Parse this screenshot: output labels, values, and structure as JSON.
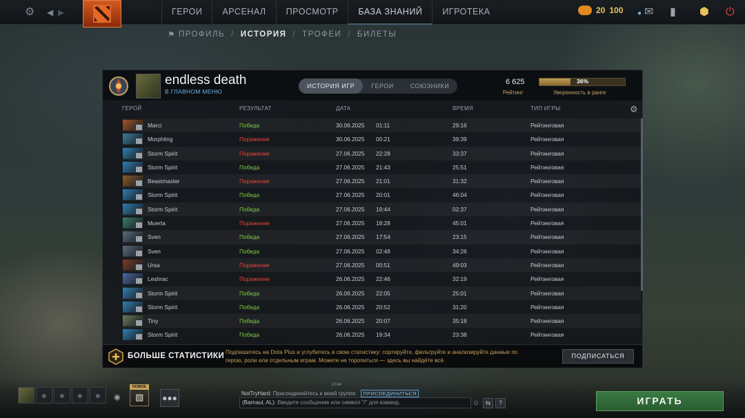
{
  "top_nav": {
    "items": [
      "ГЕРОИ",
      "АРСЕНАЛ",
      "ПРОСМОТР",
      "БАЗА ЗНАНИЙ",
      "ИГРОТЕКА"
    ],
    "currency_left": "20",
    "currency_right": "100"
  },
  "sub_nav": {
    "profile": "ПРОФИЛЬ",
    "history": "ИСТОРИЯ",
    "trophies": "ТРОФЕИ",
    "tickets": "БИЛЕТЫ"
  },
  "player": {
    "name": "endless death",
    "status": "В ГЛАВНОМ МЕНЮ"
  },
  "tabs": {
    "history": "ИСТОРИЯ ИГР",
    "heroes": "ГЕРОИ",
    "allies": "СОЮЗНИКИ"
  },
  "rating": {
    "value": "6 625",
    "label": "Рейтинг",
    "confidence_value": "36%",
    "confidence_fraction": 0.36,
    "confidence_label": "Уверенность в ранге"
  },
  "columns": {
    "hero": "ГЕРОЙ",
    "result": "РЕЗУЛЬТАТ",
    "date": "ДАТА",
    "duration": "ВРЕМЯ",
    "type": "ТИП ИГРЫ"
  },
  "matches": [
    {
      "hero": "Marci",
      "result": "Победа",
      "win": true,
      "date": "30.06.2025",
      "time": "01:11",
      "duration": "29:16",
      "type": "Рейтинговая",
      "color": "#a2532a"
    },
    {
      "hero": "Morphling",
      "result": "Поражение",
      "win": false,
      "date": "30.06.2025",
      "time": "00:21",
      "duration": "39:39",
      "type": "Рейтинговая",
      "color": "#3b7f9a"
    },
    {
      "hero": "Storm Spirit",
      "result": "Поражение",
      "win": false,
      "date": "27.06.2025",
      "time": "22:28",
      "duration": "33:37",
      "type": "Рейтинговая",
      "color": "#2f7fb0"
    },
    {
      "hero": "Storm Spirit",
      "result": "Победа",
      "win": true,
      "date": "27.06.2025",
      "time": "21:43",
      "duration": "25:51",
      "type": "Рейтинговая",
      "color": "#2f7fb0"
    },
    {
      "hero": "Beastmaster",
      "result": "Поражение",
      "win": false,
      "date": "27.06.2025",
      "time": "21:01",
      "duration": "31:32",
      "type": "Рейтинговая",
      "color": "#8a5a2a"
    },
    {
      "hero": "Storm Spirit",
      "result": "Победа",
      "win": true,
      "date": "27.06.2025",
      "time": "20:01",
      "duration": "46:04",
      "type": "Рейтинговая",
      "color": "#2f7fb0"
    },
    {
      "hero": "Storm Spirit",
      "result": "Победа",
      "win": true,
      "date": "27.06.2025",
      "time": "19:44",
      "duration": "02:37",
      "type": "Рейтинговая",
      "color": "#2f7fb0"
    },
    {
      "hero": "Muerta",
      "result": "Поражение",
      "win": false,
      "date": "27.06.2025",
      "time": "18:28",
      "duration": "45:01",
      "type": "Рейтинговая",
      "color": "#3a7a6a"
    },
    {
      "hero": "Sven",
      "result": "Победа",
      "win": true,
      "date": "27.06.2025",
      "time": "17:54",
      "duration": "23:15",
      "type": "Рейтинговая",
      "color": "#5a6a7a"
    },
    {
      "hero": "Sven",
      "result": "Победа",
      "win": true,
      "date": "27.06.2025",
      "time": "02:48",
      "duration": "34:26",
      "type": "Рейтинговая",
      "color": "#5a6a7a"
    },
    {
      "hero": "Ursa",
      "result": "Поражение",
      "win": false,
      "date": "27.06.2025",
      "time": "00:51",
      "duration": "49:03",
      "type": "Рейтинговая",
      "color": "#7a3a2a"
    },
    {
      "hero": "Leshrac",
      "result": "Поражение",
      "win": false,
      "date": "26.06.2025",
      "time": "22:46",
      "duration": "32:19",
      "type": "Рейтинговая",
      "color": "#4a6aa0"
    },
    {
      "hero": "Storm Spirit",
      "result": "Победа",
      "win": true,
      "date": "26.06.2025",
      "time": "22:05",
      "duration": "25:01",
      "type": "Рейтинговая",
      "color": "#2f7fb0"
    },
    {
      "hero": "Storm Spirit",
      "result": "Победа",
      "win": true,
      "date": "26.06.2025",
      "time": "20:52",
      "duration": "31:20",
      "type": "Рейтинговая",
      "color": "#2f7fb0"
    },
    {
      "hero": "Tiny",
      "result": "Победа",
      "win": true,
      "date": "26.06.2025",
      "time": "20:07",
      "duration": "35:18",
      "type": "Рейтинговая",
      "color": "#6a7a5a"
    },
    {
      "hero": "Storm Spirit",
      "result": "Победа",
      "win": true,
      "date": "26.06.2025",
      "time": "19:34",
      "duration": "23:38",
      "type": "Рейтинговая",
      "color": "#2f7fb0"
    }
  ],
  "dota_plus": {
    "title": "БОЛЬШЕ СТАТИСТИКИ",
    "description": "Подпишитесь на Dota Plus и углубитесь в свою статистику: сортируйте, фильтруйте и анализируйте данные по герою, роли или отдельным играм. Можете не торопиться — здесь вы найдёте всё.",
    "subscribe": "ПОДПИСАТЬСЯ"
  },
  "bottom": {
    "badge_new": "НОВОЕ",
    "clock": "13:44",
    "chat_sender": "NotTryHard:",
    "chat_message": "Присоединяйтесь к моей группе:",
    "join": "ПРИСОЕДИНИТЬСЯ",
    "chat_channel": "(Barnaul, AL):",
    "chat_placeholder": "Введите сообщение или символ \"/\" для команд.",
    "play": "ИГРАТЬ"
  },
  "colors": {
    "win": "#7fcf45",
    "loss": "#e5463a",
    "accent_gold": "#c8a35a",
    "play_green": "#3a7b42"
  }
}
